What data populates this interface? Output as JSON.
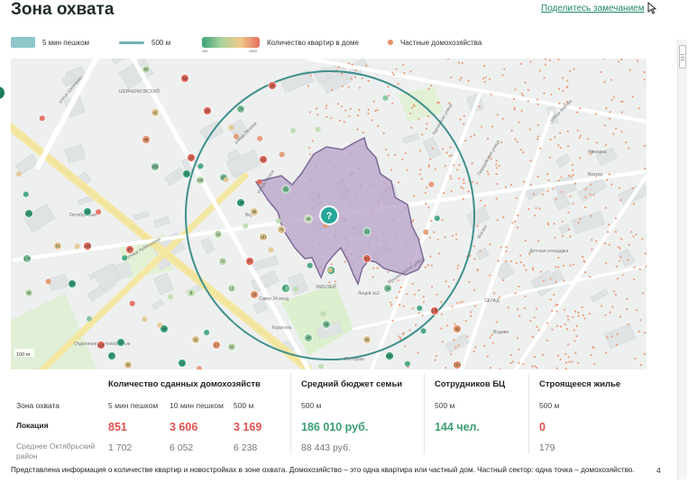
{
  "page": {
    "title": "Зона охвата",
    "share_link": "Поделитесь замечанием",
    "footer_note": "Представлена информация о количестве квартир и новостройках в зоне охвата. Домохозяйство – это одна квартира или частный дом. Частный сектор: одна точка – домохозяйство.",
    "page_number": "4"
  },
  "legend": {
    "walk_area": "5 мин пешком",
    "radius_line": "500 м",
    "apartments_gradient": "Количество квартир в доме",
    "private_houses": "Частные домохозяйства",
    "gradient_ticks": [
      "≤84",
      "≥840"
    ]
  },
  "map": {
    "scale_label": "100 m",
    "location_marker": "?",
    "colors": {
      "coverage_fill": "#b9a4c9",
      "coverage_stroke": "#7e6a98",
      "radius_circle": "#3f8f8c",
      "marker": "#27a79a",
      "private_dot": "#ec9d78",
      "road_major": "#f4e7a2",
      "park": "#dcefcf"
    },
    "labels": [
      "ШЕВЧЕНКОВСКИЙ",
      "улица Шевченко",
      "улица Ленина",
      "Октябрьская",
      "улица Куйбышева",
      "улица Гоголя",
      "Гвардейская улица",
      "Пролетарская улица",
      "Кировская улица",
      "улица Кирова",
      "Вектор",
      "Вкус",
      "СКЛАД",
      "Водное",
      "Карусель",
      "Отделение почтовой связи",
      "Лицей №2",
      "Сквер 24 вход",
      "ЗАБУЗЕЙ",
      "Ресторан",
      "Ярмарка",
      "Детская площадка",
      "Вокзал"
    ],
    "building_counts": [
      "60",
      "59",
      "42",
      "29",
      "76",
      "18",
      "48",
      "22",
      "203",
      "52",
      "122",
      "55",
      "174",
      "53",
      "105",
      "97",
      "40",
      "58",
      "209",
      "60",
      "15",
      "106",
      "72",
      "77",
      "16",
      "9",
      "12",
      "18",
      "70",
      "59",
      "99",
      "46",
      "14",
      "24",
      "33",
      "91",
      "22",
      "181",
      "43",
      "64",
      "32",
      "17",
      "118",
      "27",
      "30",
      "63",
      "12",
      "178",
      "42",
      "58",
      "40",
      "80",
      "180",
      "167"
    ]
  },
  "stats": {
    "row_labels": [
      "Зона охвата",
      "Локация",
      "Среднее Октябрьский район"
    ],
    "households": {
      "header": "Количество сданных домохозяйств",
      "columns": [
        {
          "sub": "5 мин пешком",
          "location": "851",
          "average": "1 702"
        },
        {
          "sub": "10 мин пешком",
          "location": "3 606",
          "average": "6 052"
        },
        {
          "sub": "500 м",
          "location": "3 169",
          "average": "6 238"
        }
      ]
    },
    "budget": {
      "header": "Средний бюджет семьи",
      "sub": "500 м",
      "location": "186 010 руб.",
      "average": "88 443 руб."
    },
    "employees": {
      "header": "Сотрудников БЦ",
      "sub": "500 м",
      "location": "144 чел.",
      "average": ""
    },
    "construction": {
      "header": "Строящееся жилье",
      "sub": "500 м",
      "location": "0",
      "average": "179"
    }
  }
}
